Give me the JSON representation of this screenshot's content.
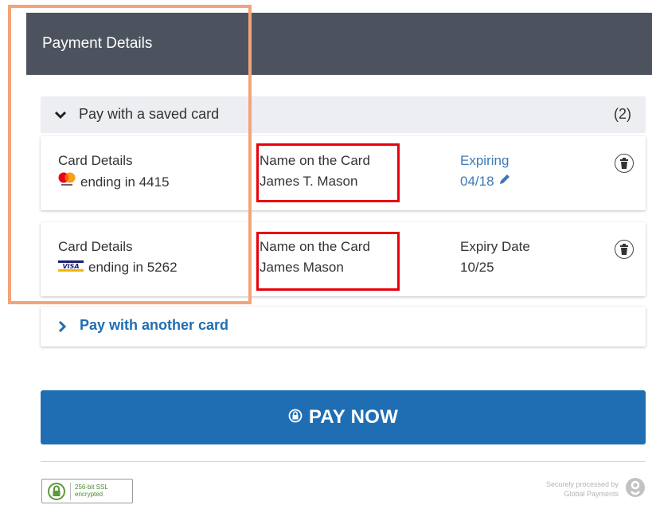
{
  "header": {
    "title": "Payment Details"
  },
  "saved_cards": {
    "label": "Pay with a saved card",
    "count": "(2)",
    "cards": [
      {
        "details_label": "Card Details",
        "brand": "mastercard-icon",
        "ending": "ending in 4415",
        "name_label": "Name on the Card",
        "name": "James T. Mason",
        "expiry_label": "Expiring",
        "expiry": "04/18"
      },
      {
        "details_label": "Card Details",
        "brand": "visa-icon",
        "visa_text": "VISA",
        "ending": "ending in 5262",
        "name_label": "Name on the Card",
        "name": "James Mason",
        "expiry_label": "Expiry Date",
        "expiry": "10/25"
      }
    ]
  },
  "another_card": {
    "label": "Pay with another card"
  },
  "pay_button": {
    "label": "PAY NOW"
  },
  "footer": {
    "ssl_line1": "256-bit SSL",
    "ssl_line2": "encrypted",
    "secure_line1": "Securely processed by",
    "secure_line2": "Global Payments"
  },
  "colors": {
    "header_bg": "#4d535e",
    "accent_blue": "#1f6eb4",
    "link_blue": "#3d7ab8",
    "highlight_red": "#e8000c",
    "highlight_orange": "#f4a37a"
  }
}
